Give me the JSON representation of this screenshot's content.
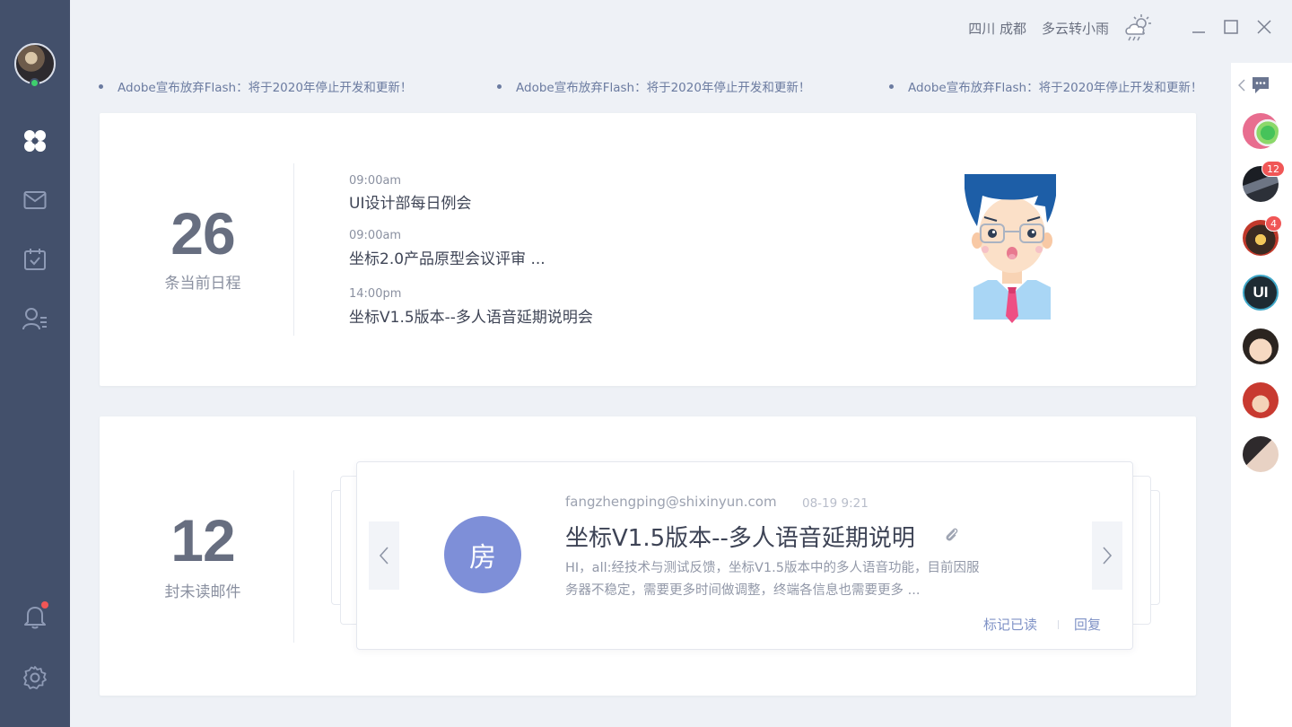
{
  "sidebar": {
    "user_online": true,
    "nav": [
      "dashboard",
      "mail",
      "calendar",
      "contacts"
    ],
    "bottom": [
      "notifications",
      "settings"
    ],
    "notification_dot": true
  },
  "topbar": {
    "location": "四川 成都",
    "weather": "多云转小雨",
    "weather_icon": "cloud-sun-rain-icon",
    "window_controls": [
      "minimize",
      "maximize",
      "close"
    ]
  },
  "ticker": {
    "items": [
      "Adobe宣布放弃Flash：将于2020年停止开发和更新！",
      "Adobe宣布放弃Flash：将于2020年停止开发和更新！",
      "Adobe宣布放弃Flash：将于2020年停止开发和更新！"
    ]
  },
  "schedule": {
    "count": "26",
    "caption": "条当前日程",
    "items": [
      {
        "time": "09:00am",
        "title": "UI设计部每日例会"
      },
      {
        "time": "09:00am",
        "title": "坐标2.0产品原型会议评审 ..."
      },
      {
        "time": "14:00pm",
        "title": "坐标V1.5版本--多人语音延期说明会"
      }
    ]
  },
  "mail": {
    "count": "12",
    "caption": "封未读邮件",
    "current": {
      "avatar_char": "房",
      "from": "fangzhengping@shixinyun.com",
      "date": "08-19  9:21",
      "subject": "坐标V1.5版本--多人语音延期说明",
      "has_attachment": true,
      "preview_line1": "HI，all:经技术与测试反馈，坐标V1.5版本中的多人语音功能，目前因服",
      "preview_line2": "务器不稳定，需要更多时间做调整，终端各信息也需要更多 ...",
      "mark_read_label": "标记已读",
      "reply_label": "回复"
    }
  },
  "contacts": {
    "items": [
      {
        "badge": ""
      },
      {
        "badge": "12"
      },
      {
        "badge": "4"
      },
      {
        "badge": "",
        "text": "UI"
      },
      {
        "badge": ""
      },
      {
        "badge": ""
      },
      {
        "badge": ""
      }
    ]
  },
  "colors": {
    "sidebar": "#43506b",
    "accent": "#7e8fd8",
    "badge": "#f05656",
    "online": "#3ecf6e"
  }
}
